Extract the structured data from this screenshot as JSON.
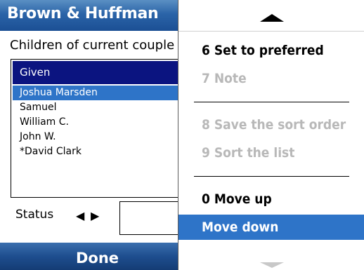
{
  "app": {
    "title": "Brown & Huffman"
  },
  "form": {
    "subtitle": "Children of current couple",
    "list": {
      "header": "Given",
      "items": [
        {
          "label": "Joshua Marsden",
          "selected": true
        },
        {
          "label": "Samuel",
          "selected": false
        },
        {
          "label": "William C.",
          "selected": false
        },
        {
          "label": "John W.",
          "selected": false
        },
        {
          "label": "*David Clark",
          "selected": false
        }
      ]
    },
    "status": {
      "label": "Status",
      "prev_arrow": "◀",
      "next_arrow": "▶",
      "value": ""
    }
  },
  "softkeys": {
    "left": "Done"
  },
  "menu": {
    "scroll_up_icon": "triangle-up",
    "scroll_down_icon": "triangle-down",
    "items": [
      {
        "label": "6 Set to preferred",
        "state": "enabled"
      },
      {
        "label": "7 Note",
        "state": "disabled"
      },
      {
        "label": "8 Save the sort order",
        "state": "disabled"
      },
      {
        "label": "9 Sort the list",
        "state": "disabled"
      },
      {
        "label": "0 Move up",
        "state": "enabled"
      },
      {
        "label": "Move down",
        "state": "highlighted"
      }
    ]
  },
  "colors": {
    "titlebar": "#2b64a8",
    "list_header": "#0b1480",
    "selection": "#2e74c8",
    "disabled_text": "#b8b8b8"
  }
}
